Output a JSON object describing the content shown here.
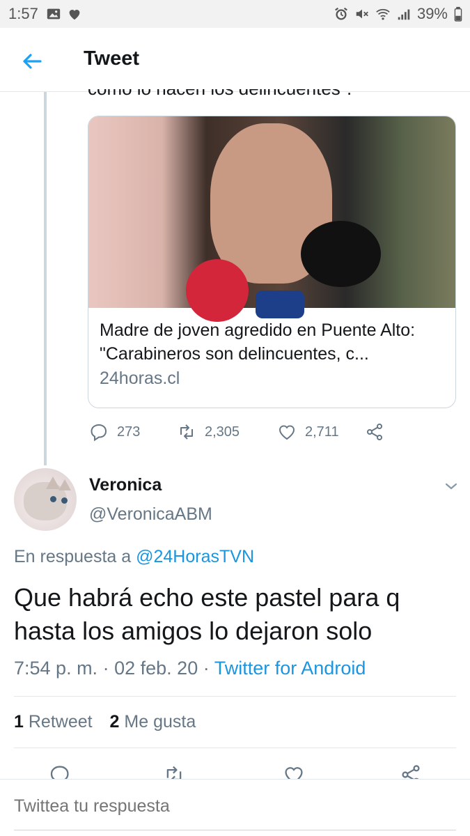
{
  "status_bar": {
    "time": "1:57",
    "battery": "39%",
    "left_icons": [
      "image-icon",
      "heart-icon"
    ],
    "right_icons": [
      "alarm-icon",
      "mute-icon",
      "wifi-icon",
      "signal-icon",
      "battery-icon"
    ]
  },
  "header": {
    "title": "Tweet",
    "back_icon": "arrow-left-icon"
  },
  "quoted_tweet": {
    "partial_text": "como lo hacen los delincuentes\".",
    "card": {
      "title": "Madre de joven agredido en Puente Alto: \"Carabineros son delincuentes, c...",
      "domain": "24horas.cl"
    },
    "actions": {
      "replies": "273",
      "retweets": "2,305",
      "likes": "2,711"
    }
  },
  "reply_tweet": {
    "display_name": "Veronica",
    "handle": "@VeronicaABM",
    "reply_prefix": "En respuesta a",
    "reply_mention": "@24HorasTVN",
    "text": "Que habrá echo este pastel para q hasta los amigos lo dejaron solo",
    "time": "7:54 p. m.",
    "separator": "·",
    "date": "02 feb. 20",
    "source": "Twitter for Android",
    "retweet_count": "1",
    "retweet_label": "Retweet",
    "like_count": "2",
    "like_label": "Me gusta"
  },
  "compose": {
    "placeholder": "Twittea tu respuesta"
  },
  "colors": {
    "accent": "#1b95e0",
    "secondary_text": "#657786",
    "divider": "#e1e8ed"
  }
}
